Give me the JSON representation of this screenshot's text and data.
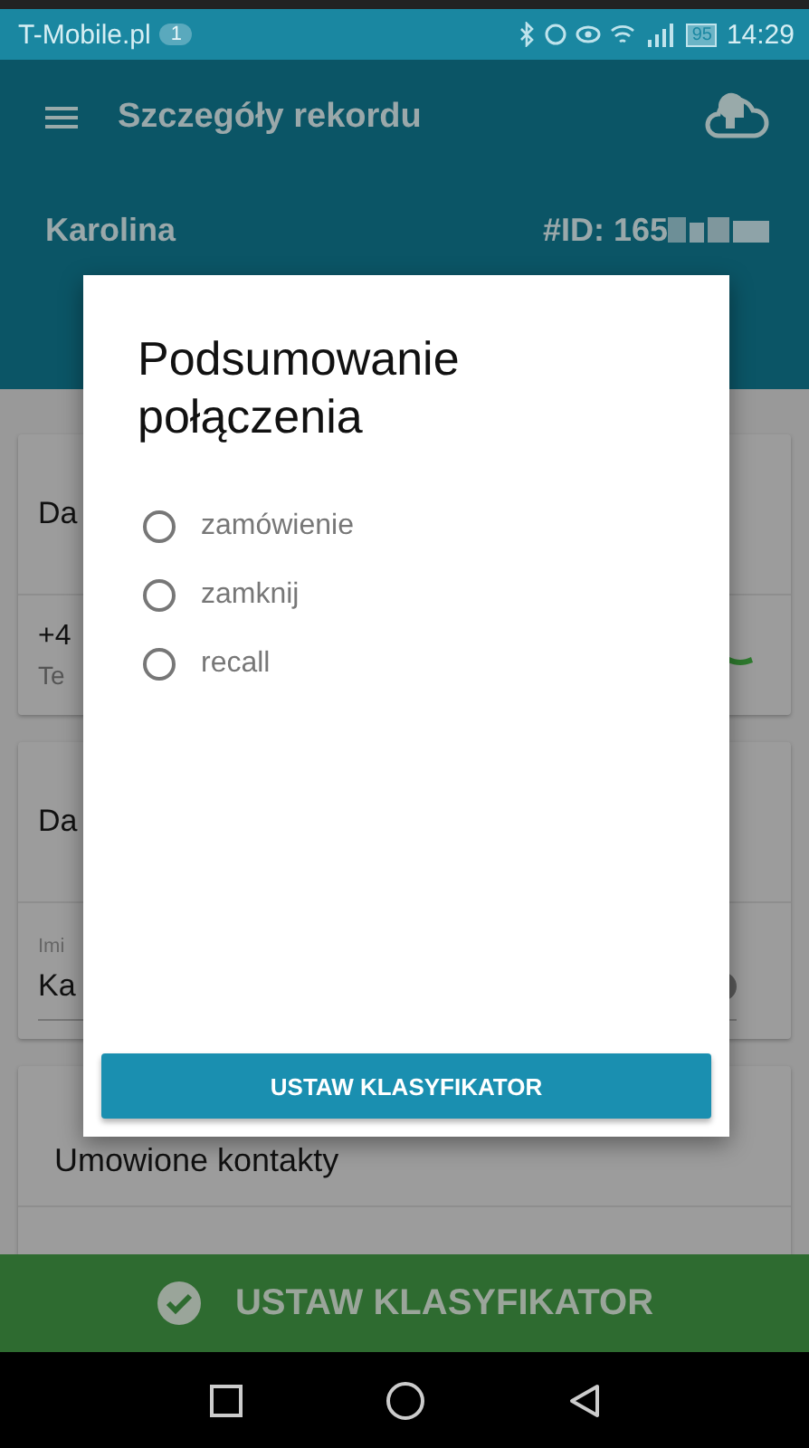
{
  "status_bar": {
    "carrier": "T-Mobile.pl",
    "notification_count": "1",
    "battery": "95",
    "time": "14:29"
  },
  "app_bar": {
    "title": "Szczegóły rekordu"
  },
  "record": {
    "name": "Karolina",
    "id": "#ID: 165"
  },
  "contact_card": {
    "title": "Da",
    "phone": "+4",
    "phone_label": "Te"
  },
  "details_card": {
    "title": "Da",
    "field_label": "Imi",
    "field_value": "Ka"
  },
  "appointments_card": {
    "title": "Umowione kontakty"
  },
  "dialog": {
    "title": "Podsumowanie połączenia",
    "options": [
      {
        "label": "zamówienie",
        "selected": false
      },
      {
        "label": "zamknij",
        "selected": false
      },
      {
        "label": "recall",
        "selected": false
      }
    ],
    "button": "USTAW KLASYFIKATOR"
  },
  "bottom_button": {
    "label": "USTAW KLASYFIKATOR"
  }
}
